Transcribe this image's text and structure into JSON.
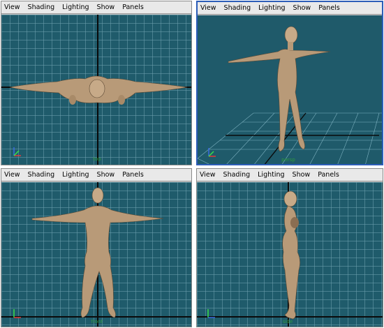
{
  "menu": [
    "View",
    "Shading",
    "Lighting",
    "Show",
    "Panels"
  ],
  "panes": {
    "top": {
      "camera": "top"
    },
    "persp": {
      "camera": "persp"
    },
    "front": {
      "camera": "front"
    },
    "side": {
      "camera": "side"
    }
  },
  "colors": {
    "viewport_bg": "#1f5b6b",
    "grid_line": "#6ea0af",
    "axis_line": "#0a0a0a",
    "active_border": "#2c5db8",
    "skin": "#b89a78",
    "label_green": "#2e9a3e"
  }
}
